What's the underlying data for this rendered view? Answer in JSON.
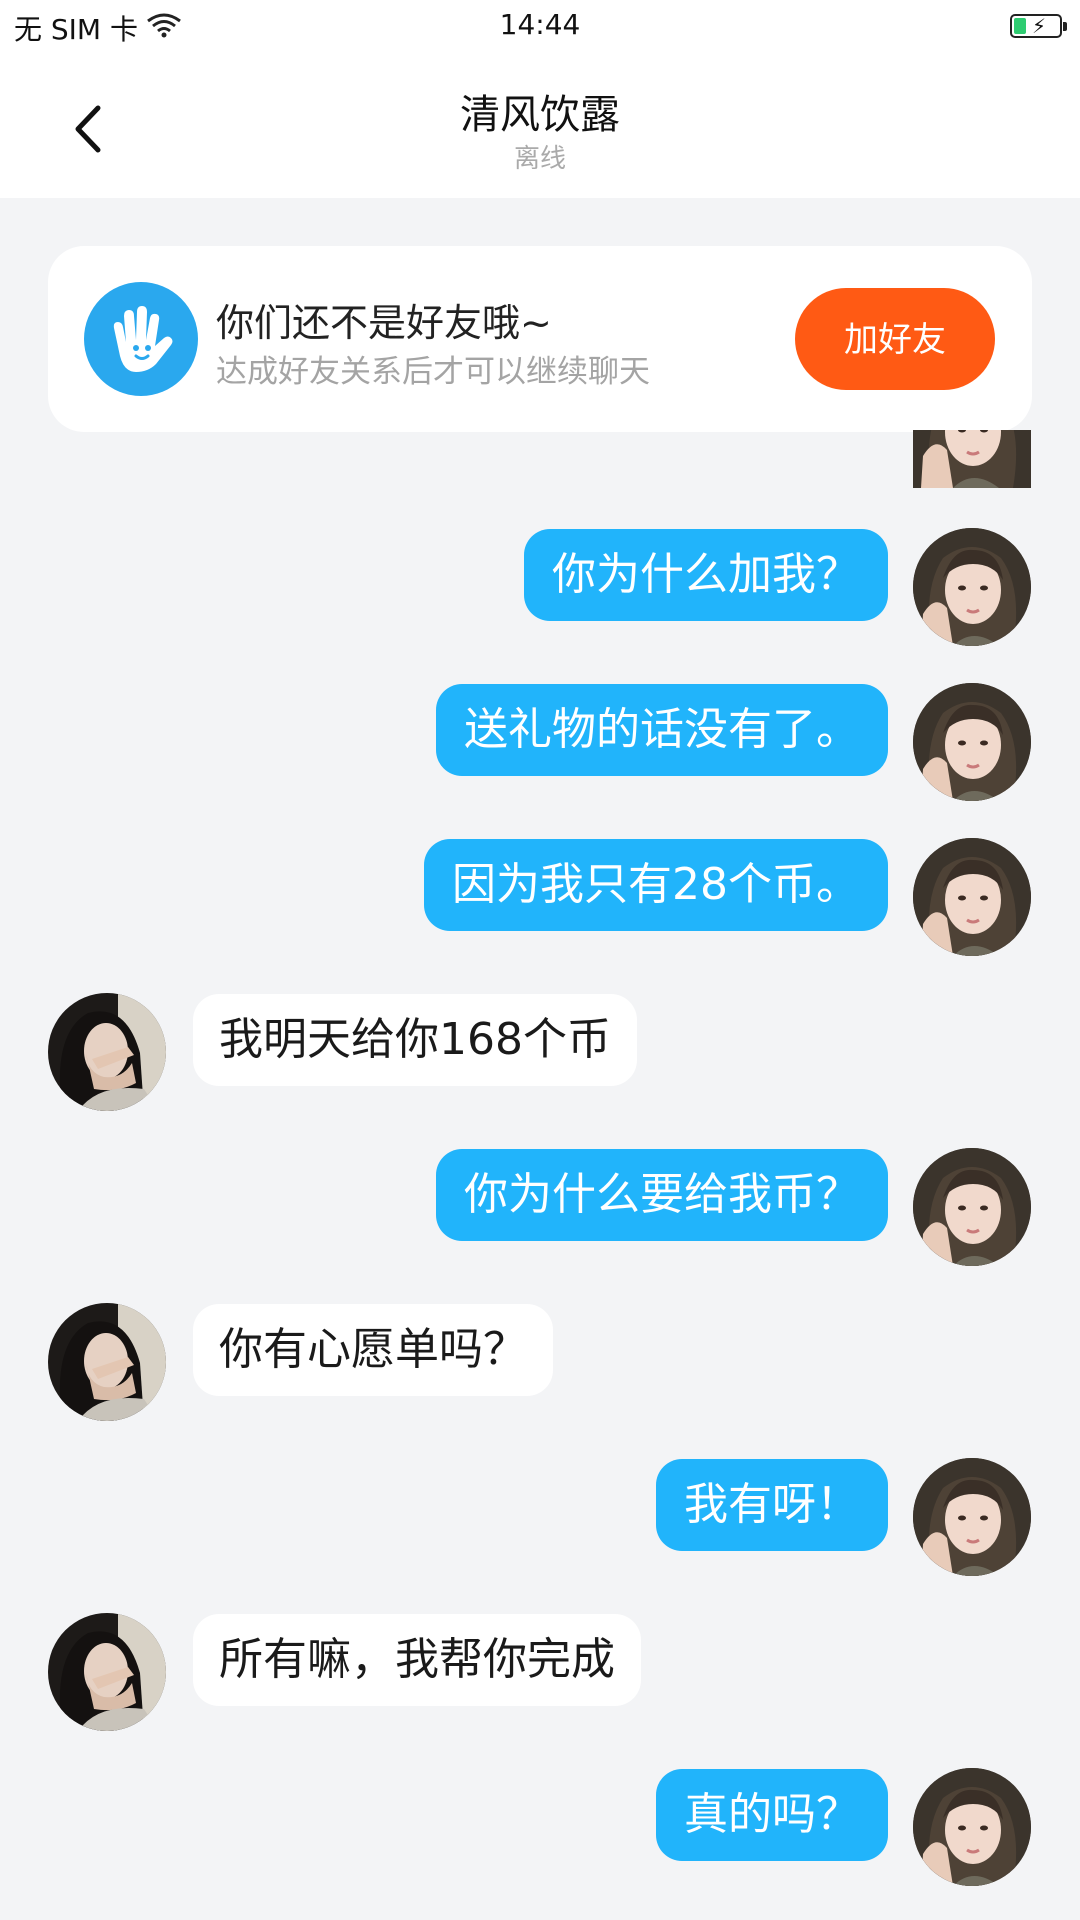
{
  "status_bar": {
    "carrier": "无 SIM 卡",
    "time": "14:44",
    "wifi_icon": "wifi-icon",
    "battery_icon": "battery-charging-icon",
    "battery_color": "#2ecc71"
  },
  "header": {
    "back_icon": "chevron-left-icon",
    "title": "清风饮露",
    "subtitle": "离线"
  },
  "friend_banner": {
    "icon": "hand-wave-icon",
    "title": "你们还不是好友哦~",
    "subtitle": "达成好友关系后才可以继续聊天",
    "button_label": "加好友",
    "button_color": "#ff5a14"
  },
  "colors": {
    "outgoing_bubble": "#21b4fb",
    "incoming_bubble": "#ffffff",
    "background": "#f3f4f6"
  },
  "messages": [
    {
      "side": "out",
      "text": "你为什么加我？"
    },
    {
      "side": "out",
      "text": "送礼物的话没有了。"
    },
    {
      "side": "out",
      "text": "因为我只有28个币。"
    },
    {
      "side": "in",
      "text": "我明天给你168个币"
    },
    {
      "side": "out",
      "text": "你为什么要给我币？"
    },
    {
      "side": "in",
      "text": "你有心愿单吗？"
    },
    {
      "side": "out",
      "text": "我有呀！"
    },
    {
      "side": "in",
      "text": "所有嘛，我帮你完成"
    },
    {
      "side": "out",
      "text": "真的吗？"
    }
  ]
}
